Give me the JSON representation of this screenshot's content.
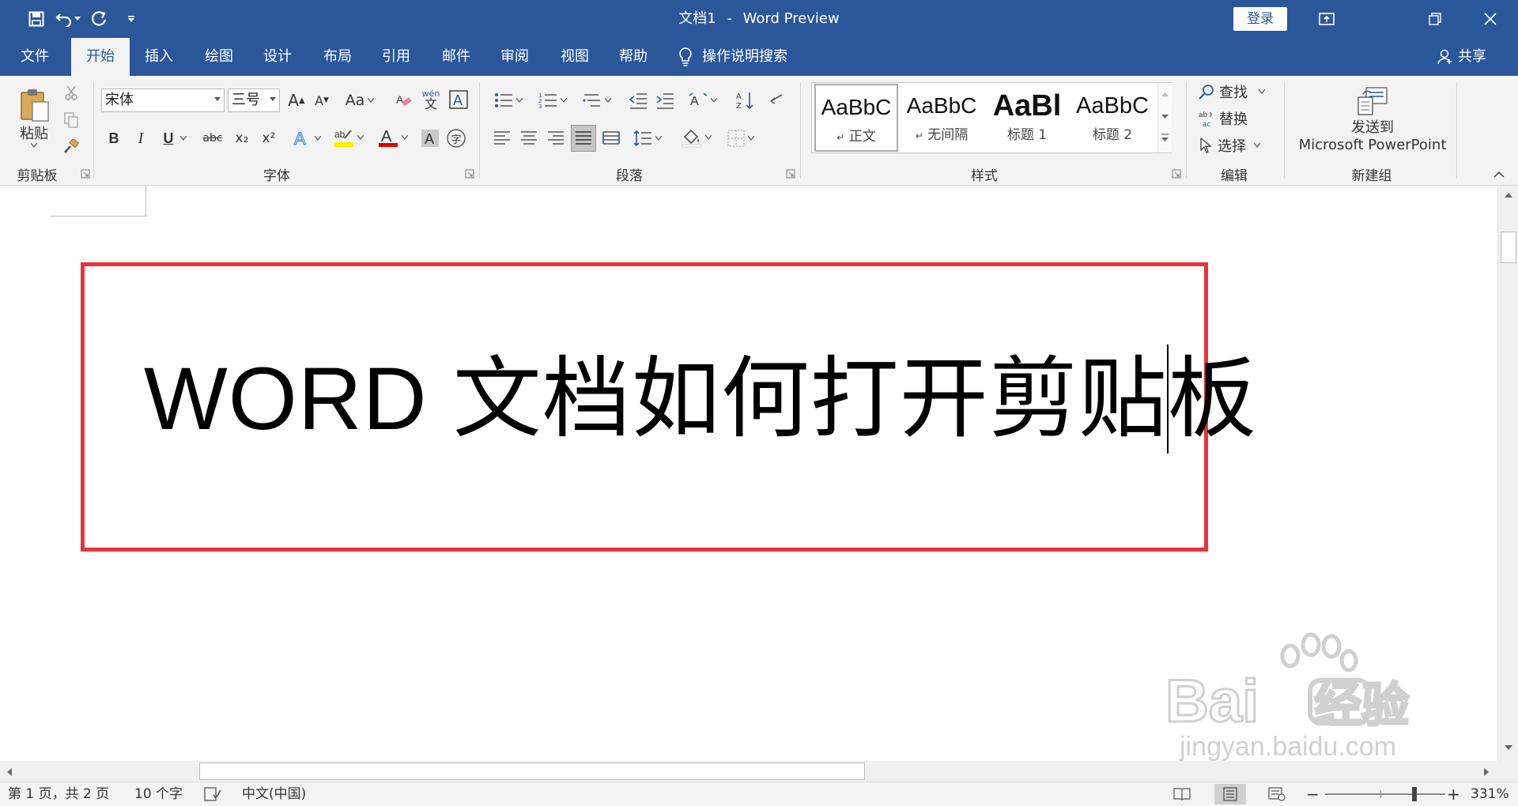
{
  "titlebar": {
    "doc_name": "文档1",
    "separator": "-",
    "app_name": "Word Preview",
    "login_label": "登录",
    "qat_icons": [
      "save-icon",
      "undo-icon",
      "redo-icon",
      "customize-icon"
    ],
    "window_icons": [
      "ribbon-display-icon",
      "restore-icon",
      "close-icon"
    ]
  },
  "tabs": {
    "items": [
      "文件",
      "开始",
      "插入",
      "绘图",
      "设计",
      "布局",
      "引用",
      "邮件",
      "审阅",
      "视图",
      "帮助"
    ],
    "active": "开始",
    "tell_me": "操作说明搜索",
    "share": "共享"
  },
  "ribbon": {
    "clipboard": {
      "paste_label": "粘贴",
      "group_label": "剪贴板"
    },
    "font": {
      "font_name": "宋体",
      "font_size": "三号",
      "case_label": "Aa",
      "group_label": "字体",
      "bold": "B",
      "italic": "I",
      "underline": "U",
      "strike": "abc",
      "subscript": "x₂",
      "superscript": "x²",
      "grow": "A",
      "shrink": "A",
      "phonetic_top": "wén",
      "phonetic_bottom": "文",
      "enclose": "字"
    },
    "paragraph": {
      "group_label": "段落"
    },
    "styles": {
      "group_label": "样式",
      "items": [
        {
          "preview": "AaBbC",
          "name": "正文",
          "mark": "↵"
        },
        {
          "preview": "AaBbC",
          "name": "无间隔",
          "mark": "↵"
        },
        {
          "preview": "AaBl",
          "name": "标题 1",
          "mark": ""
        },
        {
          "preview": "AaBbC",
          "name": "标题 2",
          "mark": ""
        }
      ]
    },
    "editing": {
      "group_label": "编辑",
      "find": "查找",
      "replace": "替换",
      "select": "选择"
    },
    "new_group": {
      "group_label": "新建组",
      "send_line1": "发送到",
      "send_line2": "Microsoft PowerPoint"
    }
  },
  "document": {
    "heading": "WORD 文档如何打开剪贴板"
  },
  "statusbar": {
    "page_info": "第 1 页，共 2 页",
    "word_count": "10 个字",
    "language": "中文(中国)",
    "zoom": "331%",
    "zoom_minus": "−",
    "zoom_plus": "+"
  },
  "watermark": {
    "brand": "Bai",
    "brand_suffix": "经验",
    "url": "jingyan.baidu.com"
  },
  "colors": {
    "brand_blue": "#2b579a",
    "highlight_red": "#e8333a",
    "ribbon_bg": "#f3f3f3"
  }
}
